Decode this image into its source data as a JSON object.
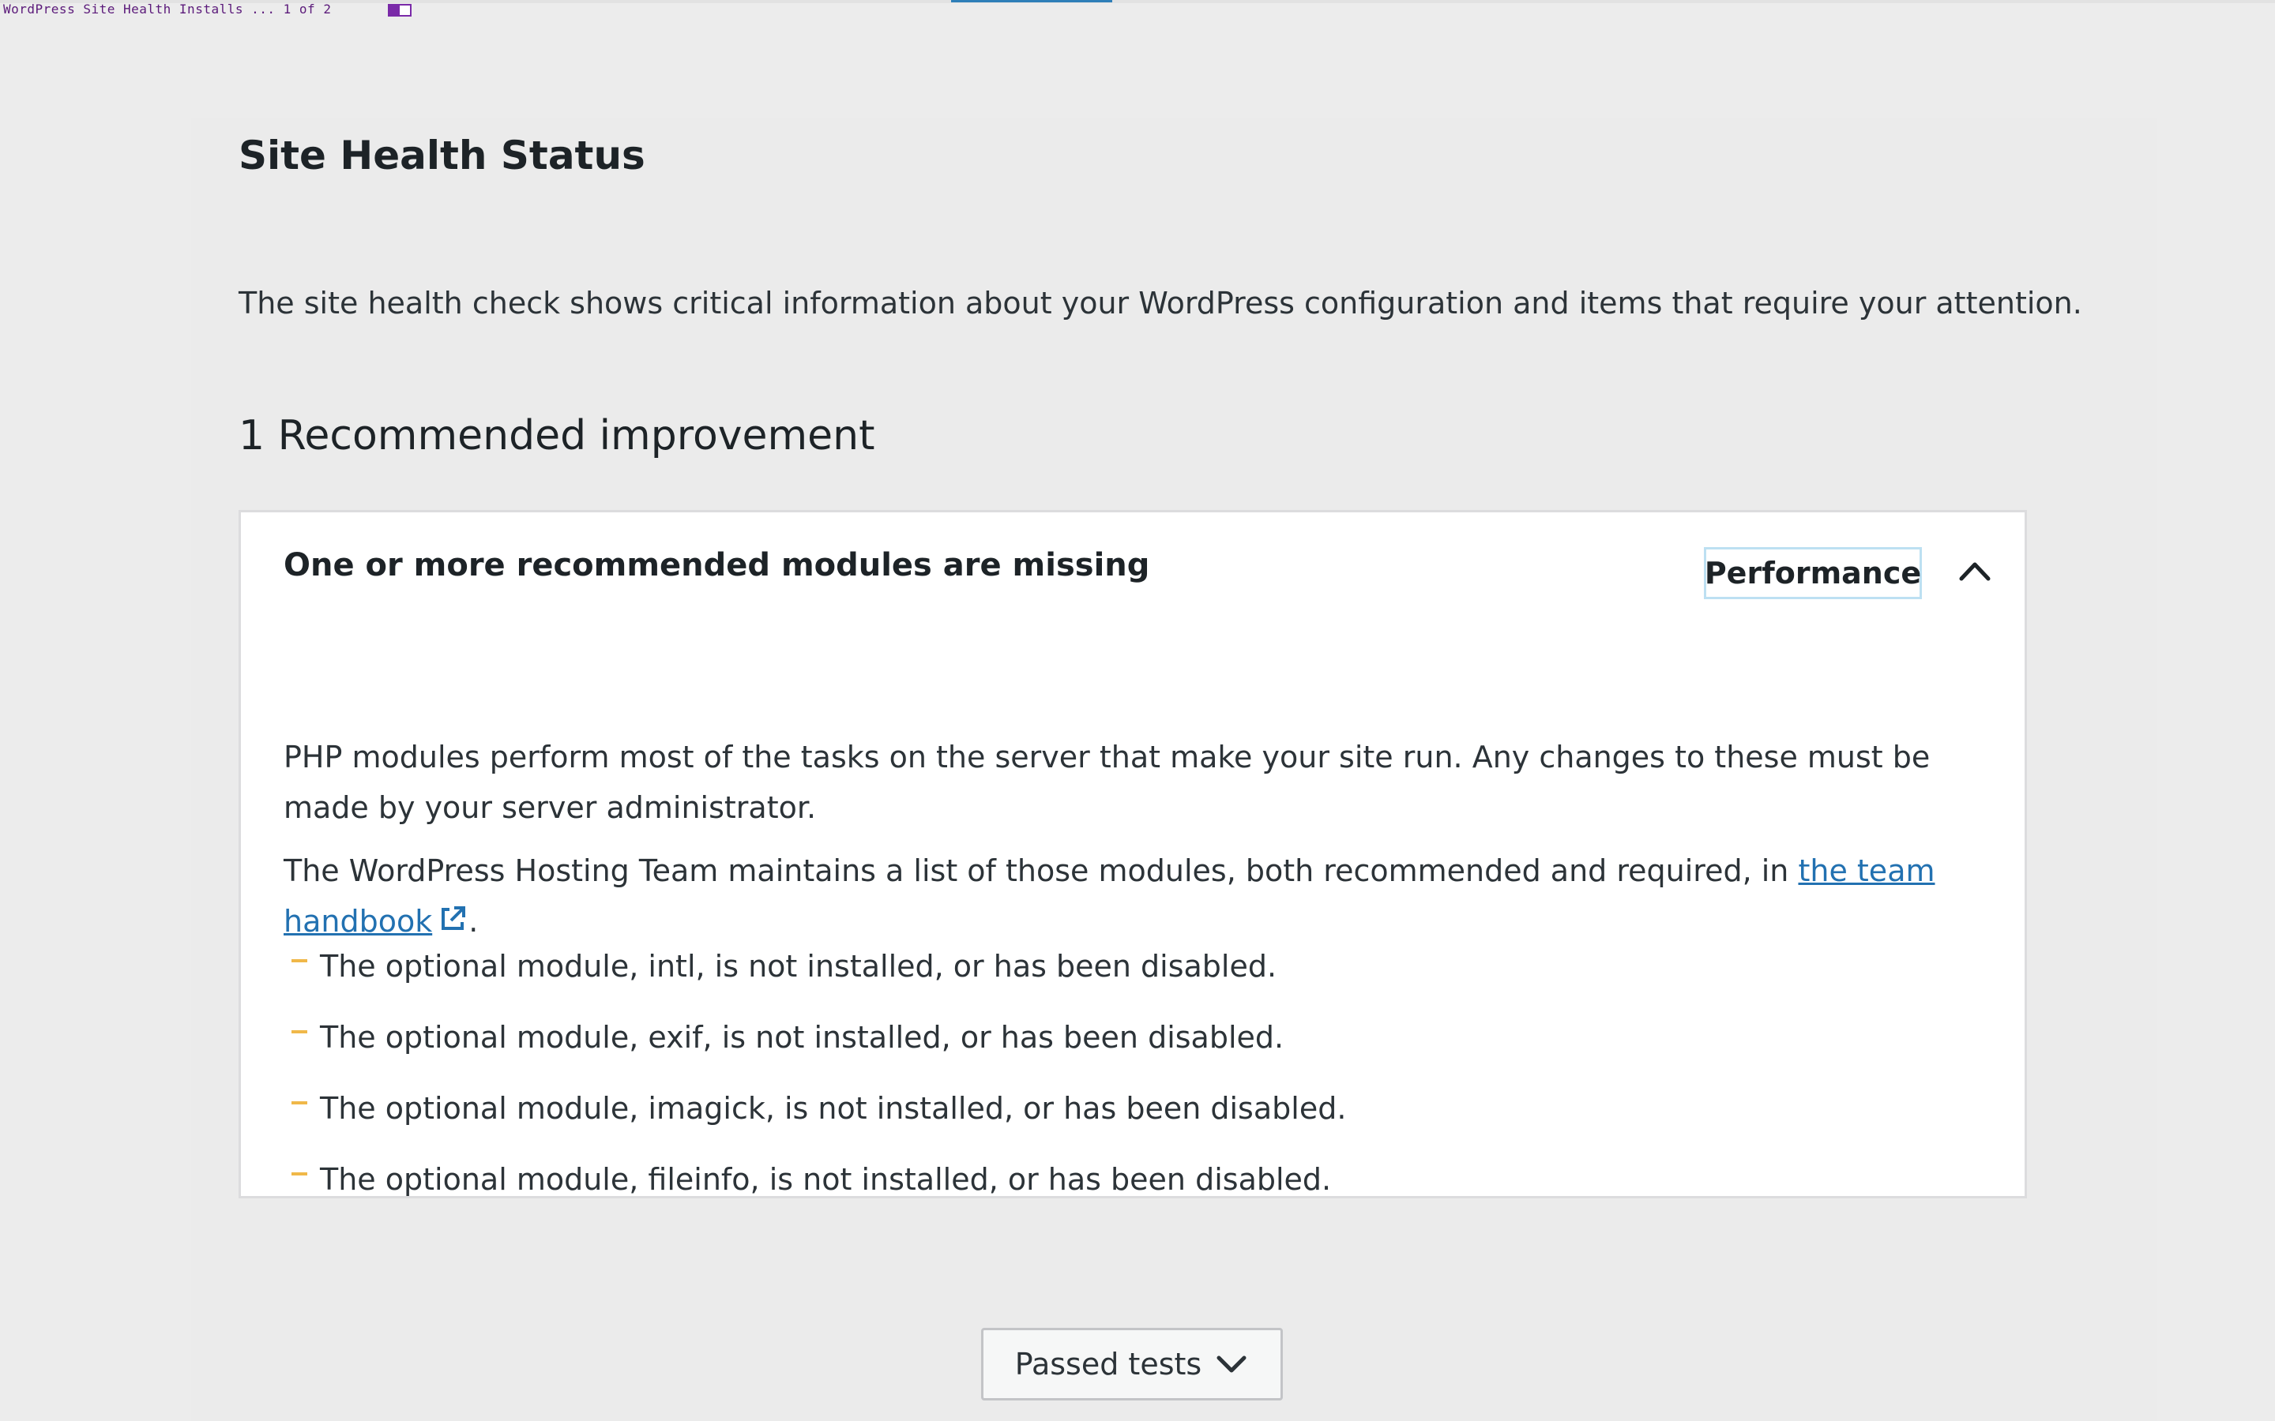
{
  "window": {
    "top_label": "WordPress Site Health Installs ... 1 of 2"
  },
  "page": {
    "title": "Site Health Status",
    "intro": "The site health check shows critical information about your WordPress configuration and items that require your attention.",
    "count_heading": "1 Recommended improvement"
  },
  "card": {
    "title": "One or more recommended modules are missing",
    "badge": "Performance",
    "toggle_icon": "chevron-up-icon",
    "para1": "PHP modules perform most of the tasks on the server that make your site run. Any changes to these must be made by your server administrator.",
    "para2_prefix": "The WordPress Hosting Team maintains a list of those modules, both recommended and required, in ",
    "para2_link": "the team handbook",
    "para2_suffix": ".",
    "link_icon": "external-link-icon",
    "modules": [
      "The optional module, intl, is not installed, or has been disabled.",
      "The optional module, exif, is not installed, or has been disabled.",
      "The optional module, imagick, is not installed, or has been disabled.",
      "The optional module, fileinfo, is not installed, or has been disabled."
    ],
    "colors": {
      "link": "#2271b1",
      "warning_dash": "#f0b849",
      "badge_border": "#bde0f2"
    }
  },
  "footer": {
    "passed_tests_label": "Passed tests",
    "toggle_icon": "chevron-down-icon"
  }
}
